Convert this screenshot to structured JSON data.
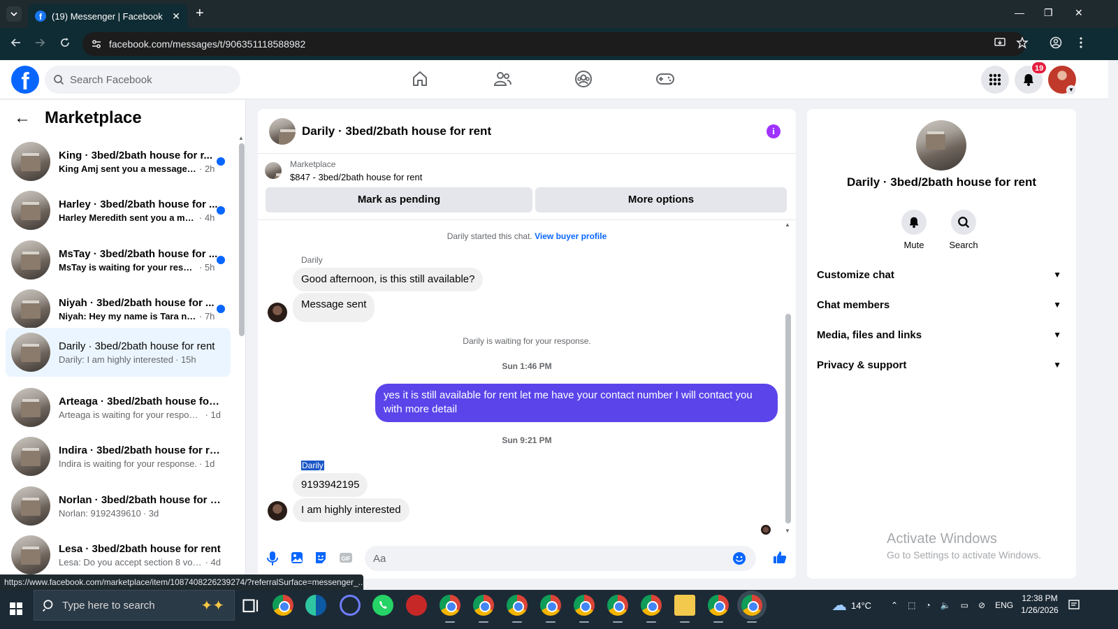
{
  "browser": {
    "tab_title": "(19) Messenger | Facebook",
    "url": "facebook.com/messages/t/906351118588982",
    "status_url": "https://www.facebook.com/marketplace/item/1087408226239274/?referralSurface=messenger_..."
  },
  "fb_header": {
    "logo": "f",
    "search_placeholder": "Search Facebook",
    "nav_icons": [
      "home-icon",
      "friends-icon",
      "groups-icon",
      "gaming-icon"
    ],
    "notification_count": "19"
  },
  "sidebar": {
    "title": "Marketplace",
    "conversations": [
      {
        "name": "King · 3bed/2bath house for r...",
        "preview": "King Amj sent you a message a...",
        "time": "· 2h",
        "unread": true
      },
      {
        "name": "Harley · 3bed/2bath house for ...",
        "preview": "Harley Meredith sent you a mes...",
        "time": "· 4h",
        "unread": true
      },
      {
        "name": "MsTay · 3bed/2bath house for ...",
        "preview": "MsTay is waiting for your respo...",
        "time": "· 5h",
        "unread": true
      },
      {
        "name": "Niyah · 3bed/2bath house for ...",
        "preview": "Niyah: Hey my name is Tara nd t...",
        "time": "· 7h",
        "unread": true
      },
      {
        "name": "Darily · 3bed/2bath house for rent",
        "preview": "Darily: I am highly interested",
        "time": "· 15h",
        "unread": false
      },
      {
        "name": "Arteaga · 3bed/2bath house for ...",
        "preview": "Arteaga is waiting for your response.",
        "time": "· 1d",
        "unread": false
      },
      {
        "name": "Indira · 3bed/2bath house for rent",
        "preview": "Indira is waiting for your response.",
        "time": "· 1d",
        "unread": false
      },
      {
        "name": "Norlan · 3bed/2bath house for r...",
        "preview": "Norlan: 9192439610",
        "time": "· 3d",
        "unread": false
      },
      {
        "name": "Lesa · 3bed/2bath house for rent",
        "preview": "Lesa: Do you accept section 8 vouc...",
        "time": "· 4d",
        "unread": false
      }
    ]
  },
  "chat": {
    "title": "Darily · 3bed/2bath house for rent",
    "marketplace_label": "Marketplace",
    "listing": "$847 - 3bed/2bath house for rent",
    "mark_pending": "Mark as pending",
    "more_options": "More options",
    "started_text": "Darily started this chat.",
    "view_buyer_profile": "View buyer profile",
    "sender1": "Darily",
    "msg1": "Good afternoon, is this still available?",
    "msg2": "Message sent",
    "waiting_text": "Darily is waiting for your response.",
    "time1": "Sun 1:46 PM",
    "outgoing": "yes it is still available for rent let me have your contact number I will contact you with more detail",
    "time2": "Sun 9:21 PM",
    "sender2": "Darily",
    "msg3": "9193942195",
    "msg4": "I am highly interested",
    "input_placeholder": "Aa"
  },
  "info_panel": {
    "name": "Darily · 3bed/2bath house for rent",
    "mute": "Mute",
    "search": "Search",
    "sections": [
      "Customize chat",
      "Chat members",
      "Media, files and links",
      "Privacy & support"
    ],
    "watermark_title": "Activate Windows",
    "watermark_sub": "Go to Settings to activate Windows."
  },
  "taskbar": {
    "search_placeholder": "Type here to search",
    "temperature": "14°C",
    "language": "ENG",
    "time": "12:38 PM",
    "date": "1/26/2026"
  },
  "colors": {
    "fb_blue": "#0866ff",
    "outgoing_bubble": "#5b44ea",
    "active_conversation": "#ebf5ff",
    "unread_dot": "#0866ff"
  }
}
